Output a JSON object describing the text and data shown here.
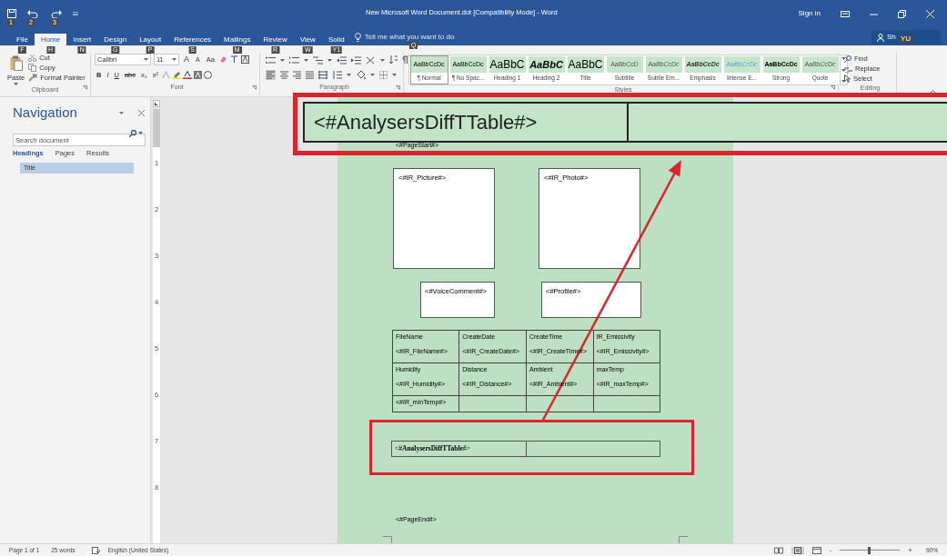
{
  "title_bar": {
    "title": "New Microsoft Word Document.dot [Compatibility Mode] - Word",
    "quick_access_keytips": [
      "1",
      "2",
      "3"
    ],
    "sign_in": "Sign in"
  },
  "tabs": [
    {
      "label": "File",
      "keytip": "F",
      "selected": false
    },
    {
      "label": "Home",
      "keytip": "H",
      "selected": true
    },
    {
      "label": "Insert",
      "keytip": "N",
      "selected": false
    },
    {
      "label": "Design",
      "keytip": "G",
      "selected": false
    },
    {
      "label": "Layout",
      "keytip": "P",
      "selected": false
    },
    {
      "label": "References",
      "keytip": "S",
      "selected": false
    },
    {
      "label": "Mailings",
      "keytip": "M",
      "selected": false
    },
    {
      "label": "Review",
      "keytip": "R",
      "selected": false
    },
    {
      "label": "View",
      "keytip": "W",
      "selected": false
    },
    {
      "label": "Solid",
      "keytip": "Y1",
      "selected": false
    }
  ],
  "tell_me": {
    "text": "Tell me what you want to do",
    "keytip": "Q"
  },
  "share": {
    "label": "Sh",
    "keytip": "YU"
  },
  "ribbon": {
    "clipboard": {
      "paste": "Paste",
      "cut": "Cut",
      "copy": "Copy",
      "format_painter": "Format Painter",
      "label": "Clipboard"
    },
    "font": {
      "font_name": "Calibri",
      "font_size": "11",
      "size_buttons": [
        "A",
        "A",
        "Aa"
      ],
      "format_buttons": [
        "B",
        "I",
        "U",
        "abc",
        "x₂",
        "x²"
      ],
      "label": "Font"
    },
    "paragraph": {
      "label": "Paragraph"
    },
    "styles": {
      "label": "Styles",
      "items": [
        {
          "sample": "AaBbCcDc",
          "name": "¶ Normal",
          "kind": "normal",
          "selected": true
        },
        {
          "sample": "AaBbCcDc",
          "name": "¶ No Spac...",
          "kind": "normal",
          "selected": false
        },
        {
          "sample": "AaBbC",
          "name": "Heading 1",
          "kind": "heading-1",
          "selected": false
        },
        {
          "sample": "AaBbC",
          "name": "Heading 2",
          "kind": "heading-2",
          "selected": false
        },
        {
          "sample": "AaBbC",
          "name": "Title",
          "kind": "title",
          "selected": false
        },
        {
          "sample": "AaBbCcD",
          "name": "Subtitle",
          "kind": "subtitle",
          "selected": false
        },
        {
          "sample": "AaBbCcDc",
          "name": "Subtle Em...",
          "kind": "subtle-emphasis",
          "selected": false
        },
        {
          "sample": "AaBbCcDc",
          "name": "Emphasis",
          "kind": "emphasis",
          "selected": false
        },
        {
          "sample": "AaBbCcDc",
          "name": "Intense E...",
          "kind": "intense-emphasis",
          "selected": false
        },
        {
          "sample": "AaBbCcDc",
          "name": "Strong",
          "kind": "strong",
          "selected": false
        },
        {
          "sample": "AaBbCcDc",
          "name": "Quote",
          "kind": "quote",
          "selected": false
        }
      ]
    },
    "editing": {
      "find": "Find",
      "replace": "Replace",
      "select": "Select",
      "label": "Editing"
    }
  },
  "navigation": {
    "title": "Navigation",
    "search_placeholder": "Search document",
    "tabs": [
      {
        "label": "Headings",
        "selected": true
      },
      {
        "label": "Pages",
        "selected": false
      },
      {
        "label": "Results",
        "selected": false
      }
    ],
    "headings": [
      {
        "label": "Title",
        "selected": true
      }
    ]
  },
  "vertical_ruler": [
    "1",
    "2",
    "3",
    "4",
    "5",
    "6",
    "7",
    "8"
  ],
  "document": {
    "page_start": "<#PageStart#>",
    "picture_boxes": [
      "<#IR_Picture#>",
      "<#IR_Photo#>"
    ],
    "small_boxes": [
      "<#VoiceComment#>",
      "<#Profile#>"
    ],
    "info_table": {
      "rows": [
        [
          {
            "title": "FileName",
            "value": "<#IR_FileName#>"
          },
          {
            "title": "CreateDate",
            "value": "<#IR_CreateDate#>"
          },
          {
            "title": "CreateTime",
            "value": "<#IR_CreateTime#>"
          },
          {
            "title": "IR_Emissivity",
            "value": "<#IR_Emissivity#>"
          }
        ],
        [
          {
            "title": "Humidity",
            "value": "<#IR_Humidity#>"
          },
          {
            "title": "Distance",
            "value": "<#IR_Distance#>"
          },
          {
            "title": "Ambient",
            "value": "<#IR_Ambient#>"
          },
          {
            "title": "maxTemp",
            "value": "<#IR_maxTemp#>"
          }
        ],
        [
          {
            "value": "<#IR_minTemp#>"
          },
          {},
          {},
          {}
        ]
      ]
    },
    "diff_table": {
      "first_cell": "<#**AnalysersDiffTTable**#>"
    },
    "page_end": "<#PageEnd#>"
  },
  "callout": {
    "text": "<#AnalysersDiffTTable#>"
  },
  "status_bar": {
    "page": "Page 1 of 1",
    "words": "25 words",
    "language": "English (United States)",
    "zoom_out": "-",
    "zoom_in": "+",
    "zoom": "90%",
    "zoom_slider": {
      "level": 0.48
    }
  }
}
